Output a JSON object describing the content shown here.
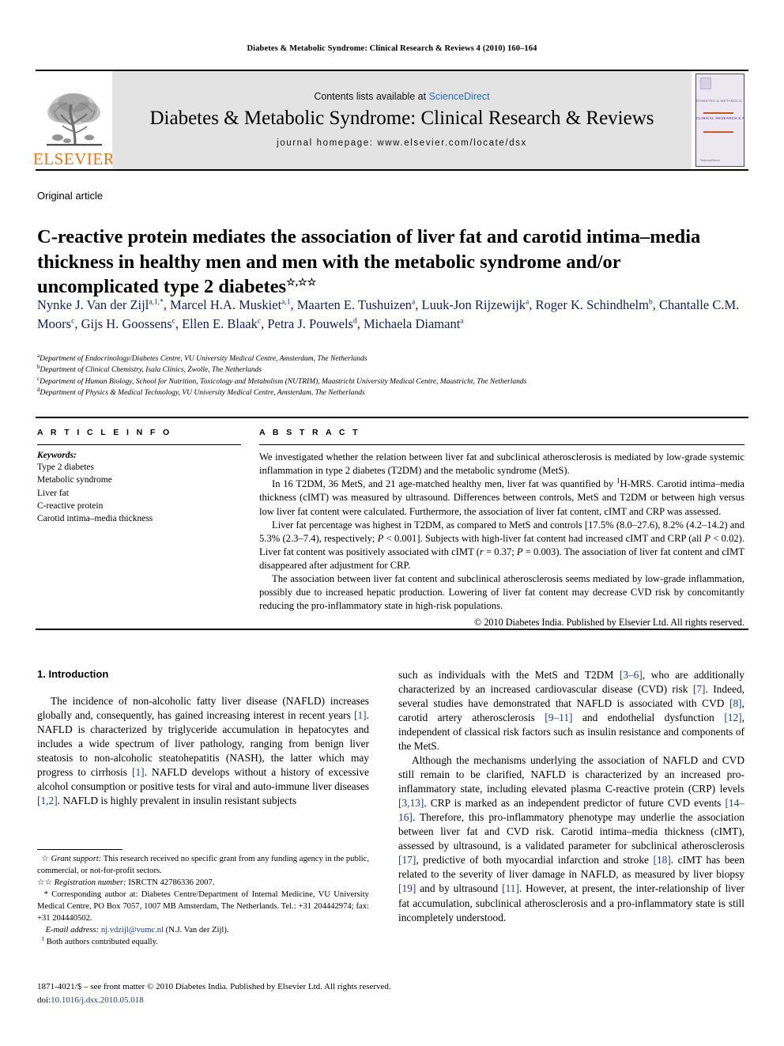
{
  "running_head": "Diabetes & Metabolic Syndrome: Clinical Research & Reviews 4 (2010) 160–164",
  "masthead": {
    "publisher_name": "ELSEVIER",
    "contents_prefix": "Contents lists available at ",
    "contents_link": "ScienceDirect",
    "journal_title": "Diabetes & Metabolic Syndrome: Clinical Research & Reviews",
    "homepage_line": "journal homepage: www.elsevier.com/locate/dsx",
    "cover": {
      "band1": "DIABETES & METABOLIC SYNDROME",
      "band2": "CLINICAL RESEARCH & REVIEWS",
      "footer": "ScienceDirect"
    }
  },
  "article": {
    "type_label": "Original article",
    "title": "C-reactive protein mediates the association of liver fat and carotid intima–media thickness in healthy men and men with the metabolic syndrome and/or uncomplicated type 2 diabetes",
    "title_marks": "☆,☆☆",
    "authors": "Nynke J. Van der Zijl a,1,*, Marcel H.A. Muskiet a,1, Maarten E. Tushuizen a, Luuk-Jon Rijzewijk a, Roger K. Schindhelm b, Chantalle C.M. Moors c, Gijs H. Goossens c, Ellen E. Blaak c, Petra J. Pouwels d, Michaela Diamant a",
    "affiliations": [
      {
        "mark": "a",
        "text": "Department of Endocrinology/Diabetes Centre, VU University Medical Centre, Amsterdam, The Netherlands"
      },
      {
        "mark": "b",
        "text": "Department of Clinical Chemistry, Isala Clinics, Zwolle, The Netherlands"
      },
      {
        "mark": "c",
        "text": "Department of Human Biology, School for Nutrition, Toxicology and Metabolism (NUTRIM), Maastricht University Medical Centre, Maastricht, The Netherlands"
      },
      {
        "mark": "d",
        "text": "Department of Physics & Medical Technology, VU University Medical Centre, Amsterdam, The Netherlands"
      }
    ]
  },
  "article_info": {
    "heading": "A R T I C L E   I N F O",
    "keywords_label": "Keywords:",
    "keywords": [
      "Type 2 diabetes",
      "Metabolic syndrome",
      "Liver fat",
      "C-reactive protein",
      "Carotid intima–media thickness"
    ]
  },
  "abstract": {
    "heading": "A B S T R A C T",
    "paragraphs": [
      "We investigated whether the relation between liver fat and subclinical atherosclerosis is mediated by low-grade systemic inflammation in type 2 diabetes (T2DM) and the metabolic syndrome (MetS).",
      "In 16 T2DM, 36 MetS, and 21 age-matched healthy men, liver fat was quantified by 1H-MRS. Carotid intima–media thickness (cIMT) was measured by ultrasound. Differences between controls, MetS and T2DM or between high versus low liver fat content were calculated. Furthermore, the association of liver fat content, cIMT and CRP was assessed.",
      "Liver fat percentage was highest in T2DM, as compared to MetS and controls [17.5% (8.0–27.6), 8.2% (4.2–14.2) and 5.3% (2.3–7.4), respectively; P < 0.001]. Subjects with high-liver fat content had increased cIMT and CRP (all P < 0.02). Liver fat content was positively associated with cIMT (r = 0.37; P = 0.003). The association of liver fat content and cIMT disappeared after adjustment for CRP.",
      "The association between liver fat content and subclinical atherosclerosis seems mediated by low-grade inflammation, possibly due to increased hepatic production. Lowering of liver fat content may decrease CVD risk by concomitantly reducing the pro-inflammatory state in high-risk populations."
    ],
    "copyright": "© 2010 Diabetes India. Published by Elsevier Ltd. All rights reserved."
  },
  "introduction": {
    "heading": "1. Introduction",
    "left_paragraph": "The incidence of non-alcoholic fatty liver disease (NAFLD) increases globally and, consequently, has gained increasing interest in recent years [1]. NAFLD is characterized by triglyceride accumulation in hepatocytes and includes a wide spectrum of liver pathology, ranging from benign liver steatosis to non-alcoholic steatohepatitis (NASH), the latter which may progress to cirrhosis [1]. NAFLD develops without a history of excessive alcohol consumption or positive tests for viral and auto-immune liver diseases [1,2]. NAFLD is highly prevalent in insulin resistant subjects",
    "right_paragraph_1": "such as individuals with the MetS and T2DM [3–6], who are additionally characterized by an increased cardiovascular disease (CVD) risk [7]. Indeed, several studies have demonstrated that NAFLD is associated with CVD [8], carotid artery atherosclerosis [9–11] and endothelial dysfunction [12], independent of classical risk factors such as insulin resistance and components of the MetS.",
    "right_paragraph_2": "Although the mechanisms underlying the association of NAFLD and CVD still remain to be clarified, NAFLD is characterized by an increased pro-inflammatory state, including elevated plasma C-reactive protein (CRP) levels [3,13]. CRP is marked as an independent predictor of future CVD events [14–16]. Therefore, this pro-inflammatory phenotype may underlie the association between liver fat and CVD risk. Carotid intima–media thickness (cIMT), assessed by ultrasound, is a validated parameter for subclinical atherosclerosis [17], predictive of both myocardial infarction and stroke [18]. cIMT has been related to the severity of liver damage in NAFLD, as measured by liver biopsy [19] and by ultrasound [11]. However, at present, the inter-relationship of liver fat accumulation, subclinical atherosclerosis and a pro-inflammatory state is still incompletely understood."
  },
  "footnotes": {
    "grant_mark": "☆",
    "grant_label": "Grant support:",
    "grant_text": " This research received no specific grant from any funding agency in the public, commercial, or not-for-profit sectors.",
    "registration_mark": "☆☆",
    "registration_label": "Registration number:",
    "registration_text": " ISRCTN 42786336 2007.",
    "corresponding_mark": "*",
    "corresponding_text": "Corresponding author at: Diabetes Centre/Department of Internal Medicine, VU University Medical Centre, PO Box 7057, 1007 MB Amsterdam, The Netherlands. Tel.: +31 204442974; fax: +31 204440502.",
    "email_label": "E-mail address:",
    "email_address": "nj.vdzijl@vumc.nl",
    "email_suffix": " (N.J. Van der Zijl).",
    "equal_contrib_mark": "1",
    "equal_contrib_text": "Both authors contributed equally."
  },
  "bottom_matter": {
    "issn_line": "1871-4021/$ – see front matter © 2010 Diabetes India. Published by Elsevier Ltd. All rights reserved.",
    "doi_prefix": "doi:",
    "doi_value": "10.1016/j.dsx.2010.05.018"
  },
  "colors": {
    "elsevier_orange": "#E87722",
    "link_blue": "#2b6cb8",
    "author_navy": "#12205c",
    "reference_blue": "#1b3c8c",
    "masthead_grey": "#e3e3e3"
  }
}
